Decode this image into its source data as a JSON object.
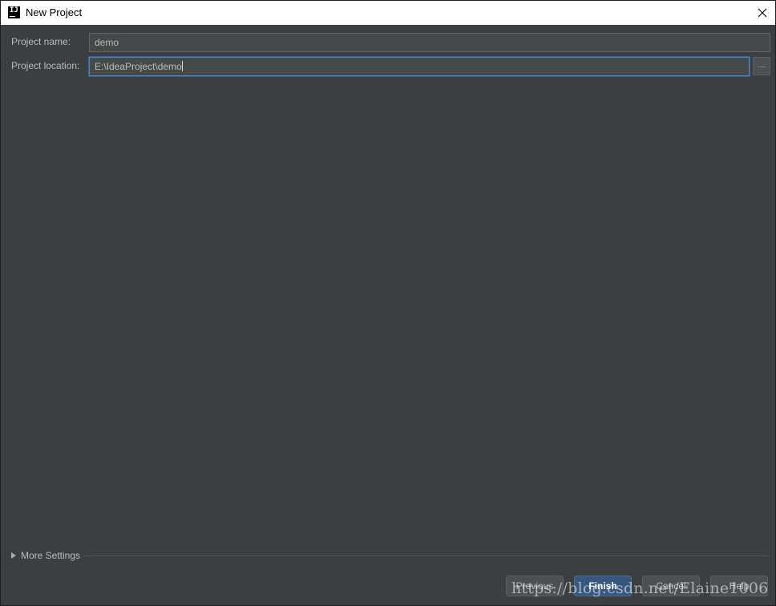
{
  "window": {
    "title": "New Project",
    "app_icon_text": "IJ"
  },
  "form": {
    "project_name_label": "Project name:",
    "project_name_value": "demo",
    "project_location_label": "Project location:",
    "project_location_value": "E:\\IdeaProject\\demo",
    "browse_label": "..."
  },
  "more_settings": {
    "label": "More Settings",
    "expanded": false
  },
  "buttons": {
    "previous": "Previous",
    "finish": "Finish",
    "cancel": "Cancel",
    "help": "Help"
  },
  "watermark": {
    "text": "https://blog.csdn.net/Elaine1006"
  },
  "colors": {
    "background": "#3c3f41",
    "field_background": "#45494a",
    "focus_border": "#4a88c7",
    "primary_button": "#365880",
    "text": "#bbbbbb"
  },
  "icons": {
    "app": "intellij-icon",
    "close": "close-icon",
    "expand": "triangle-right-icon"
  }
}
